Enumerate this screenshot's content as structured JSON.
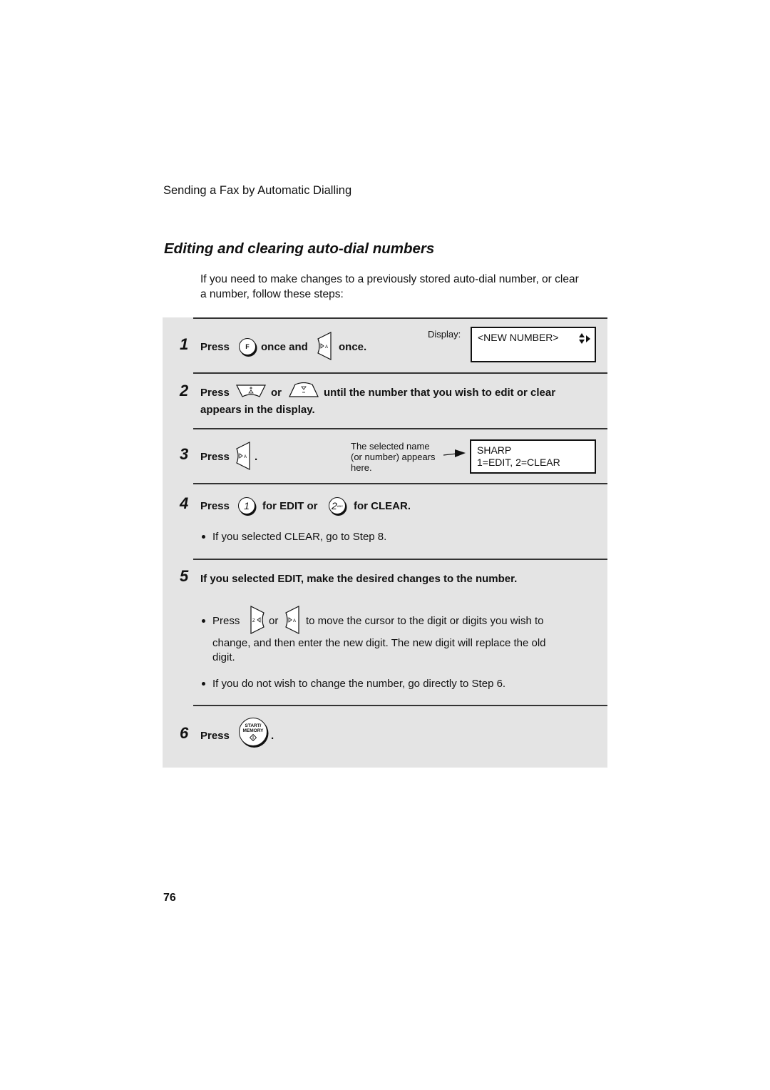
{
  "header": {
    "running_head": "Sending a Fax by Automatic Dialling"
  },
  "section": {
    "title": "Editing and clearing auto-dial numbers",
    "intro_line1": "If you need to make changes to a previously stored auto-dial number, or clear",
    "intro_line2": "a number, follow these steps:"
  },
  "steps": [
    {
      "number": "1",
      "press": "Press",
      "key1": "F",
      "mid": "once and",
      "end": "once.",
      "display_label": "Display:",
      "display_line1": "<NEW NUMBER>",
      "display_icon": "up-down-right-arrows-icon"
    },
    {
      "number": "2",
      "press": "Press",
      "or": "or",
      "rest_line1": "until the number that you wish to edit or clear",
      "rest_line2": "appears in the display."
    },
    {
      "number": "3",
      "press": "Press",
      "end": ".",
      "callout_line1": "The selected name",
      "callout_line2": "(or number) appears",
      "callout_line3": "here.",
      "display_line1": "SHARP",
      "display_line2": "1=EDIT, 2=CLEAR"
    },
    {
      "number": "4",
      "press": "Press",
      "key1": "1",
      "mid": "for EDIT or",
      "key2": "2",
      "key2_sub": "ABC",
      "end": "for CLEAR.",
      "bullet1": "If you selected CLEAR, go to Step 8."
    },
    {
      "number": "5",
      "heading": "If you selected EDIT, make the desired changes to the number.",
      "bullet1_press": "Press",
      "bullet1_or": "or",
      "bullet1_rest": "to move the cursor to the digit or digits you wish to",
      "bullet1_line2": "change, and then enter the new digit. The new digit will replace the old",
      "bullet1_line3": "digit.",
      "bullet2": "If you do not wish to change the number, go directly to Step 6."
    },
    {
      "number": "6",
      "press": "Press",
      "key_line1": "START/",
      "key_line2": "MEMORY",
      "end": "."
    }
  ],
  "footer": {
    "page_number": "76"
  }
}
